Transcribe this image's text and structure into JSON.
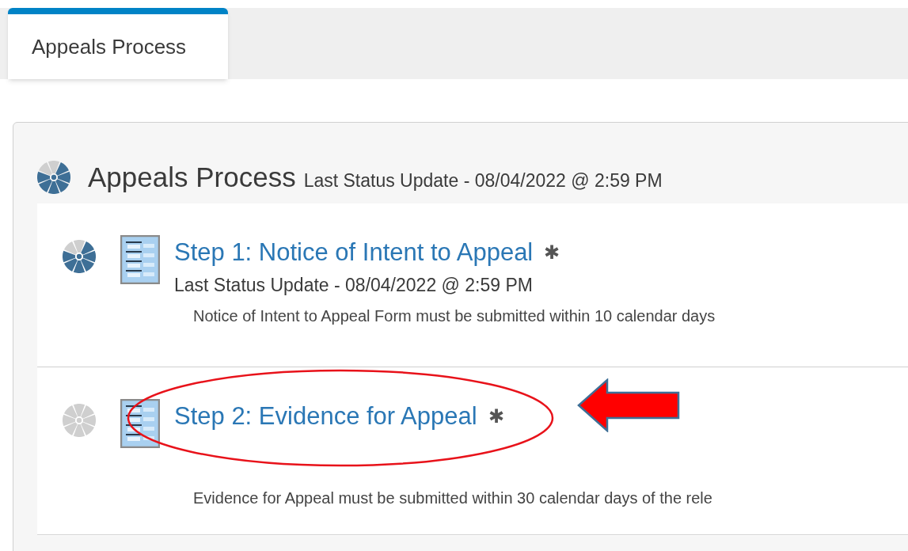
{
  "tabs": [
    {
      "label": "Appeals Process",
      "selected": true
    }
  ],
  "process": {
    "title": "Appeals Process",
    "status_text": "Last Status Update - 08/04/2022 @ 2:59 PM",
    "kind": "in_progress"
  },
  "steps": [
    {
      "title": "Step 1: Notice of Intent to Appeal",
      "marker": "✱",
      "kind": "in_progress",
      "status_text": "Last Status Update - 08/04/2022 @ 2:59 PM",
      "description": "Notice of Intent to Appeal Form must be submitted within 10 calendar days"
    },
    {
      "title": "Step 2: Evidence for Appeal",
      "marker": "✱",
      "kind": "not_started",
      "highlighted": true,
      "description": "Evidence for Appeal must be submitted within 30 calendar days of the rele"
    }
  ]
}
